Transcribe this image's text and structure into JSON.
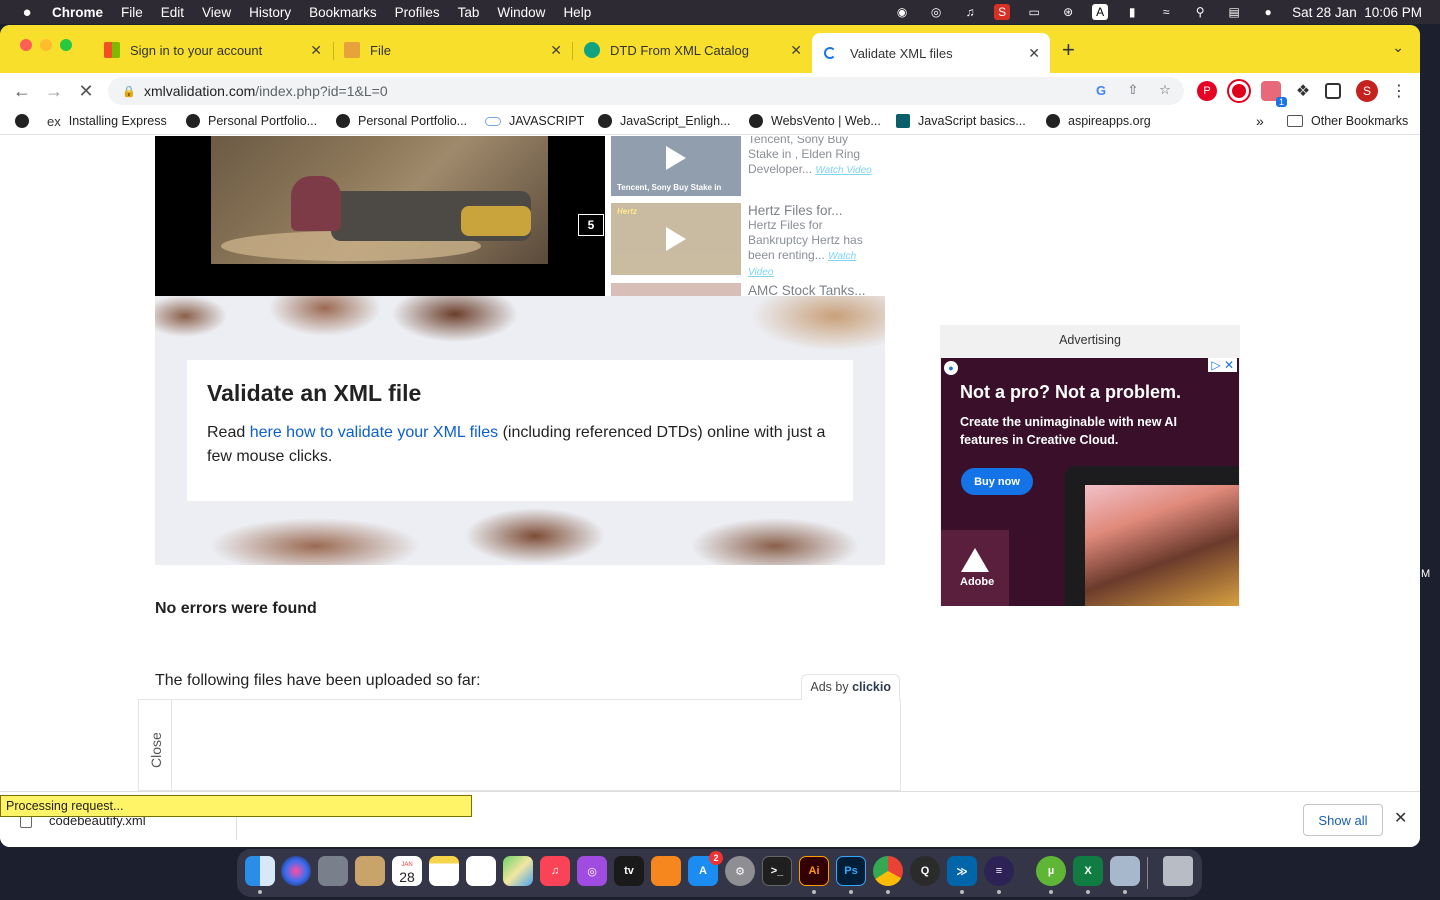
{
  "menubar": {
    "app": "Chrome",
    "items": [
      "File",
      "Edit",
      "View",
      "History",
      "Bookmarks",
      "Profiles",
      "Tab",
      "Window",
      "Help"
    ],
    "clock": "Sat 28 Jan  10:06 PM"
  },
  "tabs": [
    {
      "title": "Sign in to your account",
      "favicon_color": "#f25022"
    },
    {
      "title": "File",
      "favicon_color": "#e8a23b"
    },
    {
      "title": "DTD From XML Catalog",
      "favicon_color": "#10a37f"
    },
    {
      "title": "Validate XML files",
      "favicon_color": "#1a73e8"
    }
  ],
  "address": {
    "host": "xmlvalidation.com",
    "path": "/index.php?id=1&L=0"
  },
  "bookmarks": [
    {
      "label": "Installing Express",
      "icon": "ex-icon"
    },
    {
      "label": "Personal Portfolio...",
      "icon": "globe-icon"
    },
    {
      "label": "Personal Portfolio...",
      "icon": "globe-icon"
    },
    {
      "label": "JAVASCRIPT",
      "icon": "cloud-icon"
    },
    {
      "label": "JavaScript_Enligh...",
      "icon": "globe-icon"
    },
    {
      "label": "WebsVento | Web...",
      "icon": "globe-icon"
    },
    {
      "label": "JavaScript basics...",
      "icon": "bookmark-square-icon"
    },
    {
      "label": "aspireapps.org",
      "icon": "globe-icon"
    }
  ],
  "bookmarks_more": "»",
  "other_bookmarks": "Other Bookmarks",
  "profile_initial": "S",
  "video": {
    "badge": "5",
    "items": [
      {
        "title": "",
        "desc": "Tencent, Sony Buy Stake in , Elden Ring Developer...",
        "watch": "Watch Video",
        "thumb_caption": "Tencent, Sony Buy Stake in"
      },
      {
        "title": "Hertz Files for...",
        "desc": "Hertz Files for Bankruptcy Hertz has been renting...",
        "watch": "Watch Video",
        "thumb_caption": "Hertz"
      },
      {
        "title": "AMC Stock Tanks...",
        "desc": "",
        "watch": "",
        "thumb_caption": ""
      }
    ]
  },
  "hero": {
    "title": "Validate an XML file",
    "text_before": "Read ",
    "link": "here how to validate your XML files",
    "text_after": " (including referenced DTDs) online with just a few mouse clicks."
  },
  "result": {
    "status": "No errors were found",
    "uploaded_label": "The following files have been uploaded so far:"
  },
  "ad": {
    "label": "Advertising",
    "headline": "Not a pro? Not a problem.",
    "sub": "Create the unimaginable with new AI features in Creative Cloud.",
    "cta": "Buy now",
    "brand": "Adobe"
  },
  "clickio": {
    "label_prefix": "Ads by ",
    "label_brand": "clickio",
    "close": "Close"
  },
  "status_bar": "Processing request...",
  "downloads": {
    "file": "codebeautify.xml",
    "show_all": "Show all"
  },
  "desk_letter": "M",
  "calendar": {
    "month": "JAN",
    "day": "28"
  },
  "appstore_badge": "2",
  "ext_badge": "1"
}
